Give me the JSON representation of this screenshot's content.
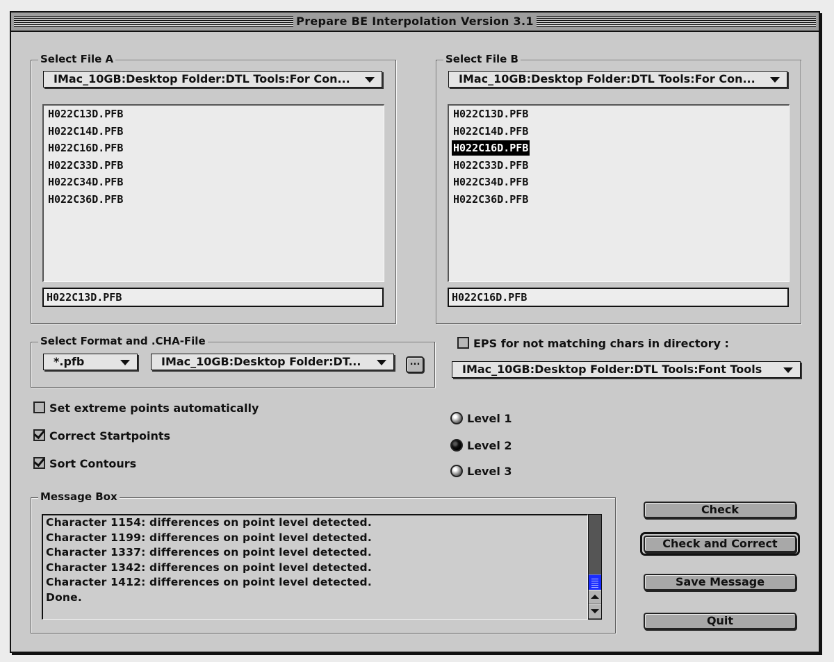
{
  "window": {
    "title": "Prepare BE Interpolation Version 3.1"
  },
  "file_a": {
    "group_label": "Select File A",
    "path_popup": "IMac_10GB:Desktop Folder:DTL Tools:For Con...",
    "files": [
      "H022C13D.PFB",
      "H022C14D.PFB",
      "H022C16D.PFB",
      "H022C33D.PFB",
      "H022C34D.PFB",
      "H022C36D.PFB"
    ],
    "selected_index": null,
    "filename_value": "H022C13D.PFB"
  },
  "file_b": {
    "group_label": "Select File B",
    "path_popup": "IMac_10GB:Desktop Folder:DTL Tools:For Con...",
    "files": [
      "H022C13D.PFB",
      "H022C14D.PFB",
      "H022C16D.PFB",
      "H022C33D.PFB",
      "H022C34D.PFB",
      "H022C36D.PFB"
    ],
    "selected_index": 2,
    "filename_value": "H022C16D.PFB"
  },
  "format": {
    "group_label": "Select Format and .CHA-File",
    "format_popup": "*.pfb",
    "cha_popup": "IMac_10GB:Desktop Folder:DT...",
    "browse_label": "..."
  },
  "eps": {
    "checkbox_label": "EPS for not matching chars in directory :",
    "checked": false,
    "dir_popup": "IMac_10GB:Desktop Folder:DTL Tools:Font Tools"
  },
  "options": [
    {
      "label": "Set extreme points automatically",
      "checked": false
    },
    {
      "label": "Correct Startpoints",
      "checked": true
    },
    {
      "label": "Sort Contours",
      "checked": true
    }
  ],
  "levels": {
    "options": [
      "Level 1",
      "Level 2",
      "Level 3"
    ],
    "selected_index": 1
  },
  "message_box": {
    "group_label": "Message Box",
    "lines": [
      "Character 1154: differences on point level detected.",
      "Character 1199: differences on point level detected.",
      "Character 1337: differences on point level detected.",
      "Character 1342: differences on point level detected.",
      "Character 1412: differences on point level detected.",
      "Done."
    ],
    "scroll_position": 1.0
  },
  "buttons": {
    "check": "Check",
    "check_and_correct": "Check and Correct",
    "save_message": "Save Message",
    "quit": "Quit"
  },
  "colors": {
    "scroll_thumb": "#1a2cff",
    "window_bg": "#cacaca"
  }
}
